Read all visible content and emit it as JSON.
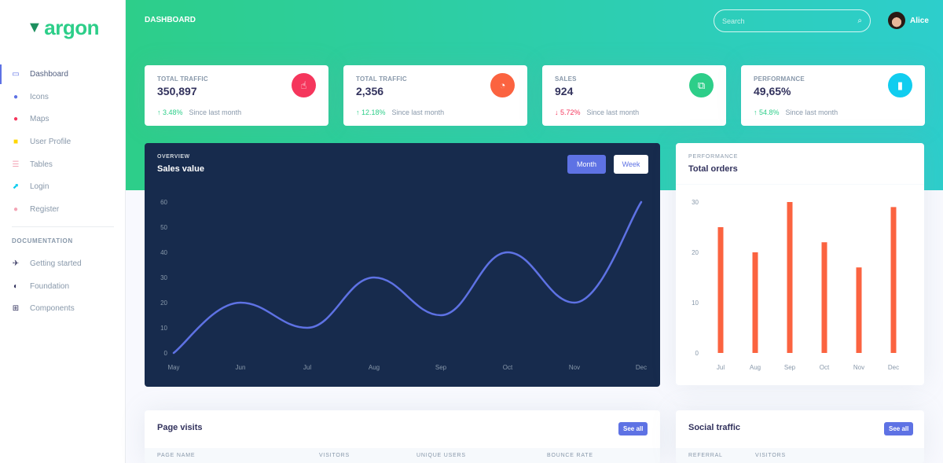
{
  "sidebar": {
    "brand": "argon",
    "items": [
      {
        "label": "Dashboard",
        "icon": "tv-icon",
        "color": "#5e72e4",
        "active": true
      },
      {
        "label": "Icons",
        "icon": "planet-icon",
        "color": "#5e72e4"
      },
      {
        "label": "Maps",
        "icon": "pin-icon",
        "color": "#f5365c"
      },
      {
        "label": "User Profile",
        "icon": "user-icon",
        "color": "#ffd600"
      },
      {
        "label": "Tables",
        "icon": "list-icon",
        "color": "#f3a4b5"
      },
      {
        "label": "Login",
        "icon": "key-icon",
        "color": "#11cdef"
      },
      {
        "label": "Register",
        "icon": "circle-user-icon",
        "color": "#f3a4b5"
      }
    ],
    "docs_heading": "Documentation",
    "docs": [
      {
        "label": "Getting started",
        "icon": "spaceship-icon"
      },
      {
        "label": "Foundation",
        "icon": "palette-icon"
      },
      {
        "label": "Components",
        "icon": "ui-components-icon"
      }
    ]
  },
  "header": {
    "title": "Dashboard",
    "search_placeholder": "Search",
    "user_name": "Alice"
  },
  "stats": [
    {
      "label": "Total traffic",
      "value": "350,897",
      "change": "3.48%",
      "direction": "up",
      "since": "Since last month",
      "icon_color": "#f5365c",
      "icon": "hand-pointer-icon",
      "glyph": "☝"
    },
    {
      "label": "Total traffic",
      "value": "2,356",
      "change": "12.18%",
      "direction": "up",
      "since": "Since last month",
      "icon_color": "#fb6340",
      "icon": "chart-pie-icon",
      "glyph": "◔"
    },
    {
      "label": "Sales",
      "value": "924",
      "change": "5.72%",
      "direction": "down",
      "since": "Since last month",
      "icon_color": "#2dce89",
      "icon": "money-coins-icon",
      "glyph": "⧉"
    },
    {
      "label": "Performance",
      "value": "49,65%",
      "change": "54.8%",
      "direction": "up",
      "since": "Since last month",
      "icon_color": "#11cdef",
      "icon": "chart-bar-icon",
      "glyph": "▮"
    }
  ],
  "sales_card": {
    "eyebrow": "Overview",
    "title": "Sales value",
    "btn_month": "Month",
    "btn_week": "Week"
  },
  "orders_card": {
    "eyebrow": "Performance",
    "title": "Total orders"
  },
  "page_visits": {
    "title": "Page visits",
    "see_all": "See all",
    "columns": [
      "Page name",
      "Visitors",
      "Unique users",
      "Bounce rate"
    ]
  },
  "social_traffic": {
    "title": "Social traffic",
    "see_all": "See all",
    "columns": [
      "Referral",
      "Visitors"
    ]
  },
  "chart_data": [
    {
      "type": "line",
      "title": "Sales value",
      "categories": [
        "May",
        "Jun",
        "Jul",
        "Aug",
        "Sep",
        "Oct",
        "Nov",
        "Dec"
      ],
      "series": [
        {
          "name": "Sales",
          "values": [
            0,
            20,
            10,
            30,
            15,
            40,
            20,
            60
          ],
          "color": "#5e72e4"
        }
      ],
      "yticks": [
        0,
        10,
        20,
        30,
        40,
        50,
        60
      ],
      "ylim": [
        0,
        60
      ],
      "xlabel": "",
      "ylabel": "",
      "grid": false
    },
    {
      "type": "bar",
      "title": "Total orders",
      "categories": [
        "Jul",
        "Aug",
        "Sep",
        "Oct",
        "Nov",
        "Dec"
      ],
      "values": [
        25,
        20,
        30,
        22,
        17,
        29
      ],
      "color": "#fb6340",
      "yticks": [
        0,
        10,
        20,
        30
      ],
      "ylim": [
        0,
        30
      ],
      "xlabel": "",
      "ylabel": "",
      "grid": false
    }
  ]
}
